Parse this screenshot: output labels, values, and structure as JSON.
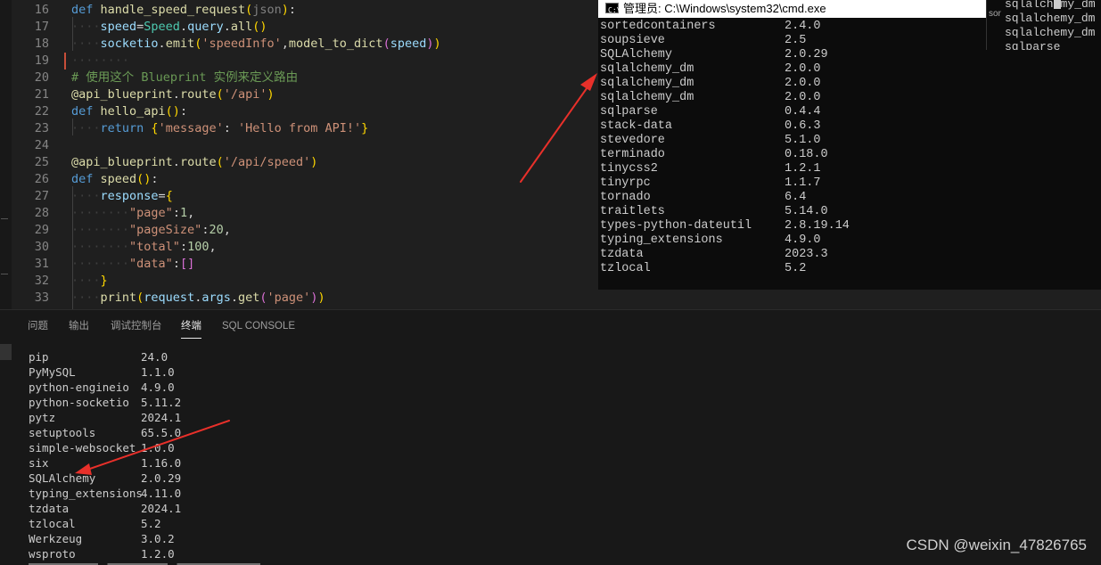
{
  "editor": {
    "lines": [
      {
        "num": "16",
        "tokens": [
          [
            "kw",
            "def "
          ],
          [
            "fn",
            "handle_speed_request"
          ],
          [
            "br1",
            "("
          ],
          [
            "param",
            "json"
          ],
          [
            "br1",
            ")"
          ],
          [
            "pl",
            ":"
          ]
        ]
      },
      {
        "num": "17",
        "tokens": [
          [
            "ws",
            "····"
          ],
          [
            "var",
            "speed"
          ],
          [
            "pl",
            "="
          ],
          [
            "cls",
            "Speed"
          ],
          [
            "pl",
            "."
          ],
          [
            "var",
            "query"
          ],
          [
            "pl",
            "."
          ],
          [
            "fn",
            "all"
          ],
          [
            "br1",
            "()"
          ]
        ]
      },
      {
        "num": "18",
        "tokens": [
          [
            "ws",
            "····"
          ],
          [
            "var",
            "socketio"
          ],
          [
            "pl",
            "."
          ],
          [
            "fn",
            "emit"
          ],
          [
            "br1",
            "("
          ],
          [
            "str",
            "'speedInfo'"
          ],
          [
            "pl",
            ","
          ],
          [
            "fn",
            "model_to_dict"
          ],
          [
            "br2",
            "("
          ],
          [
            "var",
            "speed"
          ],
          [
            "br2",
            ")"
          ],
          [
            "br1",
            ")"
          ]
        ]
      },
      {
        "num": "19",
        "tokens": [
          [
            "ws",
            "········"
          ]
        ]
      },
      {
        "num": "20",
        "tokens": [
          [
            "cmt",
            "# 使用这个 Blueprint 实例来定义路由"
          ]
        ]
      },
      {
        "num": "21",
        "tokens": [
          [
            "fn",
            "@api_blueprint"
          ],
          [
            "pl",
            "."
          ],
          [
            "fn",
            "route"
          ],
          [
            "br1",
            "("
          ],
          [
            "str",
            "'/api'"
          ],
          [
            "br1",
            ")"
          ]
        ]
      },
      {
        "num": "22",
        "tokens": [
          [
            "kw",
            "def "
          ],
          [
            "fn",
            "hello_api"
          ],
          [
            "br1",
            "()"
          ],
          [
            "pl",
            ":"
          ]
        ]
      },
      {
        "num": "23",
        "tokens": [
          [
            "ws",
            "····"
          ],
          [
            "kw",
            "return "
          ],
          [
            "br1",
            "{"
          ],
          [
            "str",
            "'message'"
          ],
          [
            "pl",
            ": "
          ],
          [
            "str",
            "'Hello from API!'"
          ],
          [
            "br1",
            "}"
          ]
        ]
      },
      {
        "num": "24",
        "tokens": []
      },
      {
        "num": "25",
        "tokens": [
          [
            "fn",
            "@api_blueprint"
          ],
          [
            "pl",
            "."
          ],
          [
            "fn",
            "route"
          ],
          [
            "br1",
            "("
          ],
          [
            "str",
            "'/api/speed'"
          ],
          [
            "br1",
            ")"
          ]
        ]
      },
      {
        "num": "26",
        "tokens": [
          [
            "kw",
            "def "
          ],
          [
            "fn",
            "speed"
          ],
          [
            "br1",
            "()"
          ],
          [
            "pl",
            ":"
          ]
        ]
      },
      {
        "num": "27",
        "tokens": [
          [
            "ws",
            "····"
          ],
          [
            "var",
            "response"
          ],
          [
            "pl",
            "="
          ],
          [
            "br1",
            "{"
          ]
        ]
      },
      {
        "num": "28",
        "tokens": [
          [
            "ws",
            "········"
          ],
          [
            "str",
            "\"page\""
          ],
          [
            "pl",
            ":"
          ],
          [
            "num",
            "1"
          ],
          [
            "pl",
            ","
          ]
        ]
      },
      {
        "num": "29",
        "tokens": [
          [
            "ws",
            "········"
          ],
          [
            "str",
            "\"pageSize\""
          ],
          [
            "pl",
            ":"
          ],
          [
            "num",
            "20"
          ],
          [
            "pl",
            ","
          ]
        ]
      },
      {
        "num": "30",
        "tokens": [
          [
            "ws",
            "········"
          ],
          [
            "str",
            "\"total\""
          ],
          [
            "pl",
            ":"
          ],
          [
            "num",
            "100"
          ],
          [
            "pl",
            ","
          ]
        ]
      },
      {
        "num": "31",
        "tokens": [
          [
            "ws",
            "········"
          ],
          [
            "str",
            "\"data\""
          ],
          [
            "pl",
            ":"
          ],
          [
            "br2",
            "[]"
          ]
        ]
      },
      {
        "num": "32",
        "tokens": [
          [
            "ws",
            "····"
          ],
          [
            "br1",
            "}"
          ]
        ]
      },
      {
        "num": "33",
        "tokens": [
          [
            "ws",
            "····"
          ],
          [
            "fn",
            "print"
          ],
          [
            "br1",
            "("
          ],
          [
            "var",
            "request"
          ],
          [
            "pl",
            "."
          ],
          [
            "var",
            "args"
          ],
          [
            "pl",
            "."
          ],
          [
            "fn",
            "get"
          ],
          [
            "br2",
            "("
          ],
          [
            "str",
            "'page'"
          ],
          [
            "br2",
            ")"
          ],
          [
            "br1",
            ")"
          ]
        ]
      }
    ]
  },
  "cmd": {
    "title": "管理员: C:\\Windows\\system32\\cmd.exe",
    "icon_text": "C:\\",
    "packages": [
      {
        "name": "sortedcontainers",
        "version": "2.4.0"
      },
      {
        "name": "soupsieve",
        "version": "2.5"
      },
      {
        "name": "SQLAlchemy",
        "version": "2.0.29"
      },
      {
        "name": "sqlalchemy_dm",
        "version": "2.0.0"
      },
      {
        "name": "sqlalchemy_dm",
        "version": "2.0.0"
      },
      {
        "name": "sqlalchemy_dm",
        "version": "2.0.0"
      },
      {
        "name": "sqlparse",
        "version": "0.4.4"
      },
      {
        "name": "stack-data",
        "version": "0.6.3"
      },
      {
        "name": "stevedore",
        "version": "5.1.0"
      },
      {
        "name": "terminado",
        "version": "0.18.0"
      },
      {
        "name": "tinycss2",
        "version": "1.2.1"
      },
      {
        "name": "tinyrpc",
        "version": "1.1.7"
      },
      {
        "name": "tornado",
        "version": "6.4"
      },
      {
        "name": "traitlets",
        "version": "5.14.0"
      },
      {
        "name": "types-python-dateutil",
        "version": "2.8.19.14"
      },
      {
        "name": "typing_extensions",
        "version": "4.9.0"
      },
      {
        "name": "tzdata",
        "version": "2023.3"
      },
      {
        "name": "tzlocal",
        "version": "5.2"
      }
    ],
    "side_prefix": "sor",
    "side_rows": [
      "sqlalch",
      "my_dm",
      "sqlalchemy_dm",
      "sqlalchemy_dm",
      "sqlparse"
    ]
  },
  "panel": {
    "tabs": [
      "问题",
      "输出",
      "调试控制台",
      "终端",
      "SQL CONSOLE"
    ],
    "active_tab_index": 3,
    "packages": [
      {
        "name": "pip",
        "version": "24.0"
      },
      {
        "name": "PyMySQL",
        "version": "1.1.0"
      },
      {
        "name": "python-engineio",
        "version": "4.9.0"
      },
      {
        "name": "python-socketio",
        "version": "5.11.2"
      },
      {
        "name": "pytz",
        "version": "2024.1"
      },
      {
        "name": "setuptools",
        "version": "65.5.0"
      },
      {
        "name": "simple-websocket",
        "version": "1.0.0"
      },
      {
        "name": "six",
        "version": "1.16.0"
      },
      {
        "name": "SQLAlchemy",
        "version": "2.0.29"
      },
      {
        "name": "typing_extensions",
        "version": "4.11.0"
      },
      {
        "name": "tzdata",
        "version": "2024.1"
      },
      {
        "name": "tzlocal",
        "version": "5.2"
      },
      {
        "name": "Werkzeug",
        "version": "3.0.2"
      },
      {
        "name": "wsproto",
        "version": "1.2.0"
      }
    ]
  },
  "watermark": "CSDN @weixin_47826765",
  "colors": {
    "arrow": "#e8302a",
    "editor_bg": "#1f1f1f",
    "cmd_bg": "#0c0c0c",
    "panel_bg": "#181818"
  }
}
